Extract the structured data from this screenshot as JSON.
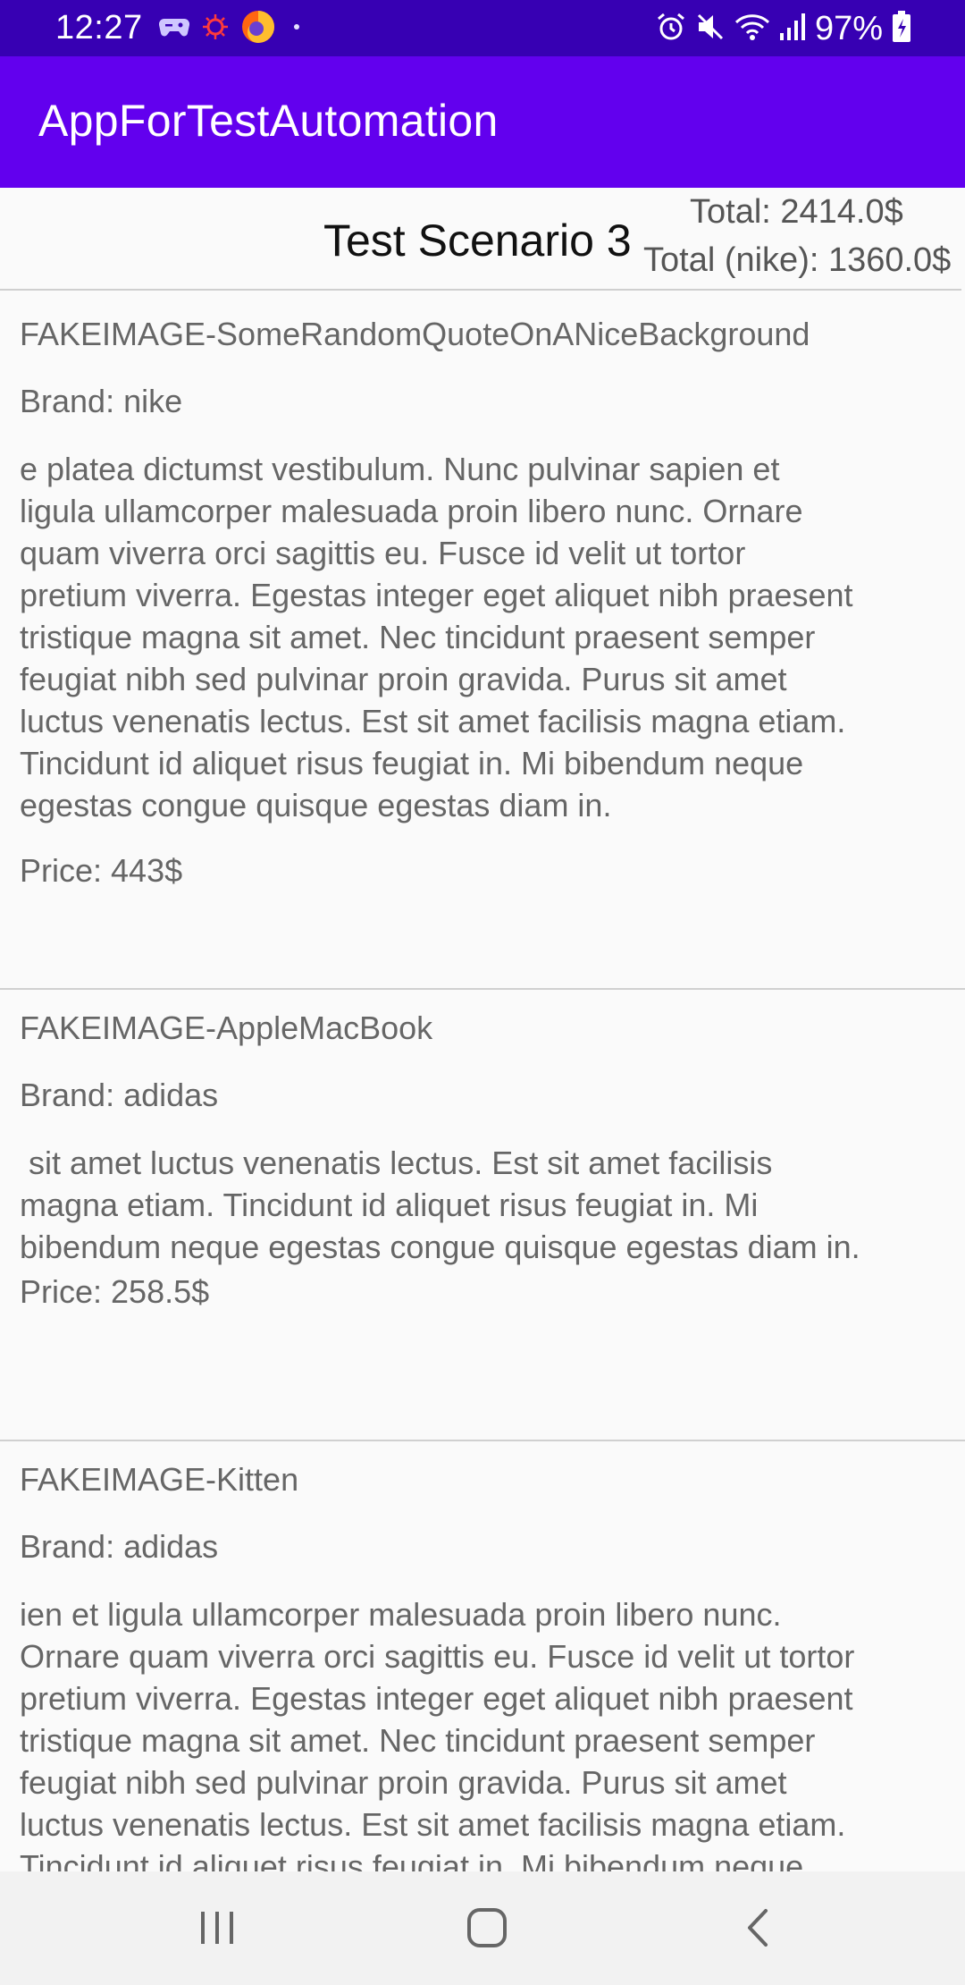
{
  "status_bar": {
    "time": "12:27",
    "battery": "97%",
    "icons": [
      "game-controller-icon",
      "virus-icon",
      "firefox-icon",
      "dot-icon",
      "alarm-icon",
      "mute-icon",
      "wifi-icon",
      "signal-icon",
      "battery-icon"
    ]
  },
  "app_bar": {
    "title": "AppForTestAutomation"
  },
  "header": {
    "title": "Test Scenario 3",
    "total": "Total: 2414.0$",
    "total_nike": "Total (nike): 1360.0$"
  },
  "items": [
    {
      "image": "FAKEIMAGE-SomeRandomQuoteOnANiceBackground",
      "brand": "Brand: nike",
      "description": "e platea dictumst vestibulum. Nunc pulvinar sapien et\nligula ullamcorper malesuada proin libero nunc. Ornare\nquam viverra orci sagittis eu. Fusce id velit ut tortor\npretium viverra. Egestas integer eget aliquet nibh praesent\ntristique magna sit amet. Nec tincidunt praesent semper\nfeugiat nibh sed pulvinar proin gravida. Purus sit amet\nluctus venenatis lectus. Est sit amet facilisis magna etiam.\nTincidunt id aliquet risus feugiat in. Mi bibendum neque\negestas congue quisque egestas diam in.",
      "price": "Price: 443$"
    },
    {
      "image": "FAKEIMAGE-AppleMacBook",
      "brand": "Brand: adidas",
      "description": " sit amet luctus venenatis lectus. Est sit amet facilisis\nmagna etiam. Tincidunt id aliquet risus feugiat in. Mi\nbibendum neque egestas congue quisque egestas diam in.",
      "price": "Price: 258.5$"
    },
    {
      "image": "FAKEIMAGE-Kitten",
      "brand": "Brand: adidas",
      "description": "ien et ligula ullamcorper malesuada proin libero nunc.\nOrnare quam viverra orci sagittis eu. Fusce id velit ut tortor\npretium viverra. Egestas integer eget aliquet nibh praesent\ntristique magna sit amet. Nec tincidunt praesent semper\nfeugiat nibh sed pulvinar proin gravida. Purus sit amet\nluctus venenatis lectus. Est sit amet facilisis magna etiam.\nTincidunt id aliquet risus feugiat in. Mi bibendum neque",
      "price": ""
    }
  ],
  "nav_bar": {
    "buttons": [
      "recents-icon",
      "home-icon",
      "back-icon"
    ]
  },
  "colors": {
    "status_bar": "#3700b3",
    "app_bar": "#6200ee",
    "background": "#fafafa"
  }
}
